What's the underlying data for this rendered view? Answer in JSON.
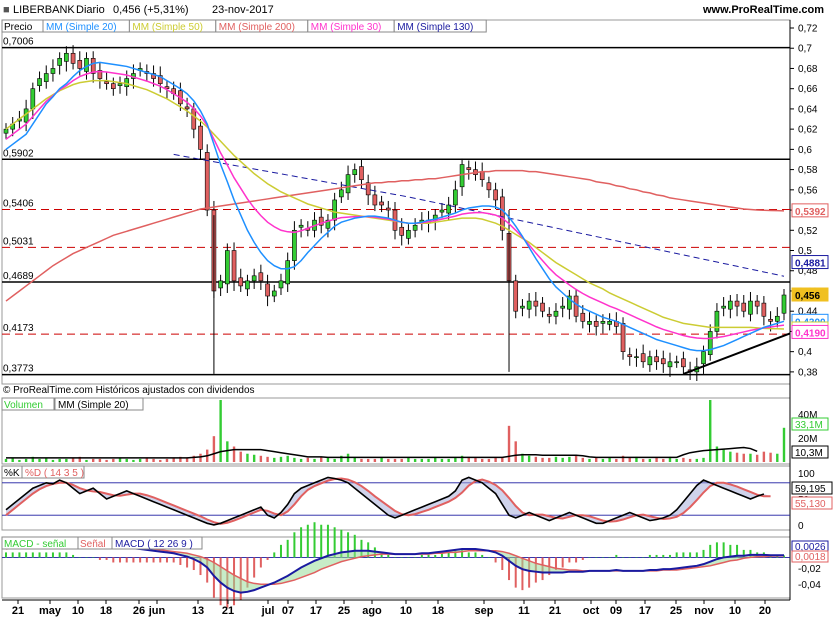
{
  "header": {
    "symbol": "LIBERBANK",
    "timeframe": "Diario",
    "last": "0,456 (+5,31%)",
    "date": "23-nov-2017",
    "site": "www.ProRealTime.com"
  },
  "price_panel": {
    "title": "Precio",
    "ma_legend": [
      {
        "label": "MM (Simple 20)",
        "color": "#1e90ff"
      },
      {
        "label": "MM (Simple 50)",
        "color": "#cccc33"
      },
      {
        "label": "MM (Simple 200)",
        "color": "#e06060"
      },
      {
        "label": "MM (Simple 30)",
        "color": "#ff33cc"
      },
      {
        "label": "MM (Simple 130)",
        "color": "#1a1aa0"
      }
    ],
    "footer": "© ProRealTime.com  Históricos ajustados con dividendos",
    "levels_solid": [
      {
        "label": "0,7006",
        "value": 0.7006
      },
      {
        "label": "0,5902",
        "value": 0.5902
      },
      {
        "label": "0,4689",
        "value": 0.4689
      },
      {
        "label": "0,3773",
        "value": 0.3773
      }
    ],
    "levels_dashed": [
      {
        "label": "0,5406",
        "value": 0.5406
      },
      {
        "label": "0,5031",
        "value": 0.5031
      },
      {
        "label": "0,4173",
        "value": 0.4173
      }
    ],
    "badges": [
      {
        "label": "0,5392",
        "value": 0.5392,
        "color": "#e06060"
      },
      {
        "label": "0,4881",
        "value": 0.4881,
        "color": "#1a1aa0"
      },
      {
        "label": "0,456",
        "value": 0.456,
        "color": "#f0c020"
      },
      {
        "label": "0,4300",
        "value": 0.43,
        "color": "#1e90ff"
      },
      {
        "label": "0,4224",
        "value": 0.4224,
        "color": "#cccc33"
      },
      {
        "label": "0,4190",
        "value": 0.419,
        "color": "#ff33cc"
      }
    ]
  },
  "volume_panel": {
    "title": "Volumen",
    "ma_label": "MM (Simple 20)",
    "axis": [
      "40M",
      "20M"
    ],
    "badges": [
      {
        "label": "33,1M",
        "color": "#33cc33"
      },
      {
        "label": "10,3M",
        "color": "#000000"
      }
    ]
  },
  "stoch_panel": {
    "k_label": "%K",
    "d_label": "%D ( 14 3 5 )",
    "axis": [
      "100",
      "50",
      "0"
    ],
    "badges": [
      {
        "label": "59,195",
        "color": "#000000"
      },
      {
        "label": "55,130",
        "color": "#e06060"
      }
    ]
  },
  "macd_panel": {
    "labels": [
      "MACD - señal",
      "Señal",
      "MACD ( 12 26 9 )"
    ],
    "axis": [
      "-0,02",
      "-0,04"
    ],
    "badges": [
      {
        "label": "0,0026",
        "color": "#1a1aa0"
      },
      {
        "label": "0,0018",
        "color": "#e06060"
      }
    ]
  },
  "x_axis": [
    "21",
    "may",
    "10",
    "18",
    "26",
    "jun",
    "13",
    "21",
    "jul",
    "07",
    "17",
    "25",
    "ago",
    "10",
    "18",
    "sep",
    "11",
    "21",
    "oct",
    "09",
    "17",
    "25",
    "nov",
    "10",
    "20"
  ],
  "chart_data": {
    "type": "candlestick",
    "title": "LIBERBANK Diario",
    "ylim": [
      0.37,
      0.72
    ],
    "y_ticks": [
      "0,72",
      "0,7",
      "0,68",
      "0,66",
      "0,64",
      "0,62",
      "0,6",
      "0,58",
      "0,56",
      "0,54",
      "0,52",
      "0,5",
      "0,48",
      "0,46",
      "0,44",
      "0,42",
      "0,4",
      "0,38"
    ],
    "close_series": [
      0.62,
      0.625,
      0.63,
      0.64,
      0.66,
      0.67,
      0.675,
      0.68,
      0.69,
      0.695,
      0.685,
      0.68,
      0.69,
      0.675,
      0.67,
      0.665,
      0.66,
      0.665,
      0.67,
      0.675,
      0.68,
      0.675,
      0.67,
      0.665,
      0.66,
      0.655,
      0.645,
      0.64,
      0.62,
      0.6,
      0.54,
      0.46,
      0.47,
      0.5,
      0.47,
      0.465,
      0.47,
      0.475,
      0.47,
      0.455,
      0.46,
      0.47,
      0.49,
      0.52,
      0.525,
      0.52,
      0.53,
      0.525,
      0.53,
      0.55,
      0.56,
      0.575,
      0.58,
      0.57,
      0.555,
      0.545,
      0.545,
      0.54,
      0.52,
      0.515,
      0.52,
      0.525,
      0.53,
      0.53,
      0.535,
      0.54,
      0.545,
      0.56,
      0.585,
      0.58,
      0.575,
      0.57,
      0.56,
      0.55,
      0.52,
      0.47,
      0.44,
      0.445,
      0.45,
      0.445,
      0.44,
      0.435,
      0.44,
      0.445,
      0.455,
      0.435,
      0.43,
      0.43,
      0.425,
      0.43,
      0.43,
      0.425,
      0.4,
      0.395,
      0.395,
      0.39,
      0.395,
      0.39,
      0.388,
      0.39,
      0.39,
      0.385,
      0.38,
      0.385,
      0.4,
      0.42,
      0.44,
      0.445,
      0.45,
      0.445,
      0.44,
      0.45,
      0.445,
      0.435,
      0.43,
      0.435,
      0.456
    ],
    "ma20": [
      0.6,
      0.605,
      0.61,
      0.615,
      0.625,
      0.635,
      0.645,
      0.652,
      0.66,
      0.665,
      0.672,
      0.678,
      0.682,
      0.685,
      0.686,
      0.685,
      0.684,
      0.683,
      0.682,
      0.68,
      0.678,
      0.676,
      0.674,
      0.672,
      0.668,
      0.664,
      0.66,
      0.655,
      0.648,
      0.638,
      0.625,
      0.605,
      0.585,
      0.568,
      0.55,
      0.535,
      0.52,
      0.508,
      0.498,
      0.49,
      0.485,
      0.482,
      0.482,
      0.484,
      0.49,
      0.498,
      0.505,
      0.512,
      0.518,
      0.524,
      0.528,
      0.53,
      0.532,
      0.533,
      0.534,
      0.534,
      0.533,
      0.532,
      0.53,
      0.528,
      0.527,
      0.527,
      0.528,
      0.53,
      0.531,
      0.533,
      0.535,
      0.537,
      0.54,
      0.542,
      0.543,
      0.544,
      0.544,
      0.543,
      0.54,
      0.533,
      0.524,
      0.514,
      0.503,
      0.492,
      0.482,
      0.472,
      0.464,
      0.458,
      0.452,
      0.447,
      0.443,
      0.44,
      0.437,
      0.434,
      0.432,
      0.43,
      0.427,
      0.424,
      0.421,
      0.418,
      0.415,
      0.412,
      0.41,
      0.408,
      0.406,
      0.404,
      0.402,
      0.401,
      0.401,
      0.402,
      0.404,
      0.406,
      0.409,
      0.412,
      0.415,
      0.418,
      0.421,
      0.424,
      0.426,
      0.428,
      0.43
    ],
    "ma50": [
      0.62,
      0.625,
      0.63,
      0.635,
      0.64,
      0.645,
      0.65,
      0.654,
      0.658,
      0.661,
      0.664,
      0.666,
      0.667,
      0.668,
      0.668,
      0.668,
      0.667,
      0.666,
      0.665,
      0.663,
      0.661,
      0.659,
      0.656,
      0.653,
      0.65,
      0.646,
      0.642,
      0.638,
      0.633,
      0.628,
      0.622,
      0.615,
      0.608,
      0.601,
      0.594,
      0.588,
      0.582,
      0.576,
      0.571,
      0.566,
      0.562,
      0.558,
      0.555,
      0.552,
      0.549,
      0.546,
      0.544,
      0.542,
      0.54,
      0.538,
      0.537,
      0.536,
      0.535,
      0.534,
      0.533,
      0.532,
      0.531,
      0.53,
      0.529,
      0.528,
      0.527,
      0.527,
      0.527,
      0.527,
      0.528,
      0.529,
      0.53,
      0.531,
      0.532,
      0.532,
      0.532,
      0.531,
      0.529,
      0.527,
      0.524,
      0.52,
      0.516,
      0.512,
      0.508,
      0.503,
      0.498,
      0.493,
      0.488,
      0.484,
      0.48,
      0.476,
      0.472,
      0.468,
      0.465,
      0.462,
      0.458,
      0.455,
      0.452,
      0.449,
      0.446,
      0.443,
      0.44,
      0.437,
      0.434,
      0.432,
      0.43,
      0.428,
      0.427,
      0.426,
      0.425,
      0.424,
      0.424,
      0.424,
      0.424,
      0.424,
      0.424,
      0.424,
      0.4235,
      0.423,
      0.4228,
      0.4226,
      0.4224
    ],
    "ma200": [
      0.45,
      0.455,
      0.46,
      0.465,
      0.47,
      0.475,
      0.48,
      0.485,
      0.489,
      0.493,
      0.497,
      0.5,
      0.503,
      0.506,
      0.509,
      0.512,
      0.515,
      0.517,
      0.519,
      0.521,
      0.523,
      0.525,
      0.527,
      0.529,
      0.531,
      0.533,
      0.535,
      0.537,
      0.539,
      0.541,
      0.542,
      0.543,
      0.544,
      0.545,
      0.546,
      0.547,
      0.548,
      0.549,
      0.55,
      0.551,
      0.552,
      0.553,
      0.554,
      0.555,
      0.556,
      0.557,
      0.558,
      0.559,
      0.56,
      0.561,
      0.562,
      0.563,
      0.564,
      0.565,
      0.566,
      0.567,
      0.567,
      0.568,
      0.568,
      0.569,
      0.569,
      0.57,
      0.57,
      0.571,
      0.571,
      0.572,
      0.573,
      0.574,
      0.575,
      0.576,
      0.577,
      0.578,
      0.578,
      0.579,
      0.579,
      0.579,
      0.579,
      0.579,
      0.578,
      0.578,
      0.577,
      0.576,
      0.575,
      0.574,
      0.573,
      0.572,
      0.571,
      0.57,
      0.568,
      0.567,
      0.566,
      0.564,
      0.563,
      0.561,
      0.56,
      0.558,
      0.557,
      0.555,
      0.554,
      0.552,
      0.551,
      0.55,
      0.549,
      0.548,
      0.547,
      0.546,
      0.545,
      0.544,
      0.543,
      0.542,
      0.541,
      0.5405,
      0.54,
      0.5398,
      0.5396,
      0.5394,
      0.5392
    ],
    "volume": [
      3,
      4,
      2,
      3,
      5,
      3,
      4,
      2,
      3,
      3,
      4,
      5,
      2,
      3,
      3,
      2,
      3,
      4,
      3,
      2,
      3,
      4,
      3,
      2,
      3,
      4,
      5,
      4,
      6,
      8,
      12,
      25,
      60,
      20,
      15,
      10,
      8,
      7,
      6,
      5,
      4,
      5,
      6,
      4,
      3,
      4,
      3,
      5,
      4,
      3,
      6,
      8,
      4,
      3,
      3,
      3,
      4,
      3,
      3,
      3,
      4,
      3,
      3,
      3,
      4,
      3,
      3,
      4,
      6,
      5,
      4,
      3,
      3,
      4,
      4,
      35,
      20,
      8,
      6,
      5,
      4,
      4,
      5,
      4,
      5,
      6,
      4,
      3,
      4,
      3,
      4,
      3,
      6,
      4,
      5,
      3,
      3,
      4,
      3,
      5,
      3,
      4,
      3,
      3,
      4,
      60,
      15,
      12,
      10,
      9,
      8,
      8,
      7,
      10,
      9,
      8,
      33.1
    ],
    "volume_ma": [
      4,
      4,
      4,
      4,
      4,
      4,
      4,
      4,
      4,
      4,
      4,
      4,
      4,
      4,
      4,
      4,
      4,
      4,
      4,
      4,
      4,
      4,
      4,
      4,
      4,
      4,
      4,
      4,
      4.5,
      5,
      6,
      8,
      10,
      11,
      12,
      12,
      12,
      12,
      12,
      11,
      10,
      9,
      8,
      7,
      6,
      5,
      5,
      5,
      4.5,
      4.5,
      4.5,
      4.5,
      4.5,
      4.5,
      4.5,
      4.5,
      4.5,
      4.5,
      4.5,
      4.5,
      4.5,
      4.5,
      4.5,
      4.5,
      4.5,
      4.5,
      4.5,
      4.5,
      4.5,
      4.5,
      4.5,
      4.5,
      4.5,
      4.5,
      4.5,
      5.5,
      6.5,
      7,
      7,
      7,
      6.5,
      6.5,
      6.5,
      6.5,
      6.5,
      6.5,
      6,
      5,
      4.5,
      4.5,
      4.5,
      4.5,
      4.5,
      4.5,
      4.5,
      4.5,
      4.5,
      4.5,
      4.5,
      4.5,
      4.5,
      7,
      9,
      10,
      11,
      11.5,
      12,
      12.5,
      13,
      13.5,
      14,
      13,
      10.3
    ],
    "stoch_k": [
      30,
      40,
      50,
      60,
      70,
      75,
      80,
      78,
      85,
      80,
      70,
      60,
      65,
      70,
      60,
      50,
      55,
      60,
      65,
      60,
      55,
      50,
      45,
      40,
      35,
      30,
      25,
      20,
      15,
      10,
      5,
      2,
      5,
      10,
      15,
      20,
      25,
      30,
      35,
      20,
      15,
      25,
      40,
      60,
      70,
      75,
      80,
      85,
      90,
      88,
      85,
      80,
      70,
      60,
      50,
      40,
      30,
      20,
      15,
      20,
      25,
      30,
      35,
      40,
      45,
      50,
      55,
      65,
      85,
      90,
      85,
      80,
      70,
      60,
      40,
      20,
      15,
      20,
      25,
      20,
      15,
      10,
      15,
      20,
      25,
      20,
      15,
      10,
      5,
      5,
      10,
      15,
      20,
      25,
      20,
      15,
      10,
      12,
      15,
      20,
      30,
      45,
      60,
      75,
      85,
      80,
      75,
      70,
      65,
      60,
      55,
      50,
      55,
      59.195
    ],
    "stoch_d": [
      20,
      30,
      40,
      50,
      60,
      68,
      74,
      78,
      80,
      80,
      76,
      70,
      66,
      64,
      63,
      60,
      57,
      56,
      58,
      60,
      60,
      57,
      53,
      48,
      43,
      38,
      33,
      28,
      23,
      18,
      12,
      7,
      4,
      6,
      10,
      15,
      20,
      25,
      30,
      28,
      23,
      20,
      27,
      40,
      55,
      67,
      74,
      79,
      84,
      87,
      88,
      86,
      81,
      74,
      65,
      55,
      46,
      37,
      28,
      22,
      20,
      22,
      26,
      30,
      35,
      40,
      45,
      52,
      62,
      75,
      83,
      86,
      82,
      76,
      66,
      52,
      37,
      25,
      20,
      21,
      21,
      18,
      15,
      14,
      17,
      20,
      20,
      18,
      14,
      10,
      8,
      9,
      12,
      16,
      20,
      21,
      18,
      15,
      13,
      14,
      17,
      24,
      35,
      48,
      62,
      74,
      80,
      80,
      77,
      73,
      68,
      63,
      58,
      55,
      55.13
    ],
    "macd": [
      0.012,
      0.013,
      0.014,
      0.015,
      0.016,
      0.017,
      0.018,
      0.018,
      0.019,
      0.019,
      0.019,
      0.018,
      0.018,
      0.017,
      0.016,
      0.015,
      0.014,
      0.013,
      0.012,
      0.011,
      0.01,
      0.009,
      0.008,
      0.007,
      0.006,
      0.005,
      0.003,
      0.001,
      -0.002,
      -0.006,
      -0.012,
      -0.022,
      -0.03,
      -0.036,
      -0.04,
      -0.042,
      -0.041,
      -0.039,
      -0.036,
      -0.033,
      -0.03,
      -0.026,
      -0.022,
      -0.017,
      -0.012,
      -0.008,
      -0.004,
      -0.001,
      0.002,
      0.004,
      0.006,
      0.007,
      0.008,
      0.008,
      0.008,
      0.007,
      0.006,
      0.005,
      0.004,
      0.004,
      0.004,
      0.004,
      0.005,
      0.005,
      0.006,
      0.007,
      0.008,
      0.009,
      0.01,
      0.01,
      0.01,
      0.009,
      0.008,
      0.006,
      0.002,
      -0.004,
      -0.01,
      -0.014,
      -0.016,
      -0.017,
      -0.018,
      -0.018,
      -0.018,
      -0.018,
      -0.017,
      -0.017,
      -0.017,
      -0.016,
      -0.016,
      -0.016,
      -0.016,
      -0.015,
      -0.016,
      -0.016,
      -0.016,
      -0.016,
      -0.015,
      -0.015,
      -0.014,
      -0.014,
      -0.013,
      -0.012,
      -0.011,
      -0.01,
      -0.008,
      -0.005,
      -0.002,
      0.0,
      0.001,
      0.002,
      0.002,
      0.003,
      0.003,
      0.003,
      0.0026,
      0.0026,
      0.0026
    ],
    "signal": [
      0.01,
      0.011,
      0.012,
      0.013,
      0.014,
      0.015,
      0.016,
      0.016,
      0.017,
      0.017,
      0.018,
      0.018,
      0.018,
      0.017,
      0.017,
      0.016,
      0.016,
      0.015,
      0.014,
      0.013,
      0.012,
      0.011,
      0.01,
      0.009,
      0.008,
      0.007,
      0.006,
      0.005,
      0.003,
      0.001,
      -0.002,
      -0.006,
      -0.011,
      -0.016,
      -0.021,
      -0.025,
      -0.029,
      -0.031,
      -0.032,
      -0.032,
      -0.032,
      -0.031,
      -0.029,
      -0.027,
      -0.024,
      -0.021,
      -0.018,
      -0.014,
      -0.011,
      -0.008,
      -0.005,
      -0.003,
      -0.001,
      0.001,
      0.002,
      0.003,
      0.004,
      0.004,
      0.004,
      0.004,
      0.004,
      0.004,
      0.004,
      0.004,
      0.005,
      0.005,
      0.006,
      0.006,
      0.007,
      0.008,
      0.008,
      0.008,
      0.008,
      0.008,
      0.007,
      0.005,
      0.002,
      -0.001,
      -0.004,
      -0.007,
      -0.009,
      -0.011,
      -0.013,
      -0.014,
      -0.015,
      -0.015,
      -0.016,
      -0.016,
      -0.016,
      -0.016,
      -0.016,
      -0.016,
      -0.016,
      -0.016,
      -0.016,
      -0.016,
      -0.016,
      -0.016,
      -0.015,
      -0.015,
      -0.015,
      -0.014,
      -0.013,
      -0.012,
      -0.011,
      -0.01,
      -0.008,
      -0.006,
      -0.004,
      -0.003,
      -0.001,
      0.0,
      0.001,
      0.001,
      0.0015,
      0.0017,
      0.0018
    ]
  }
}
